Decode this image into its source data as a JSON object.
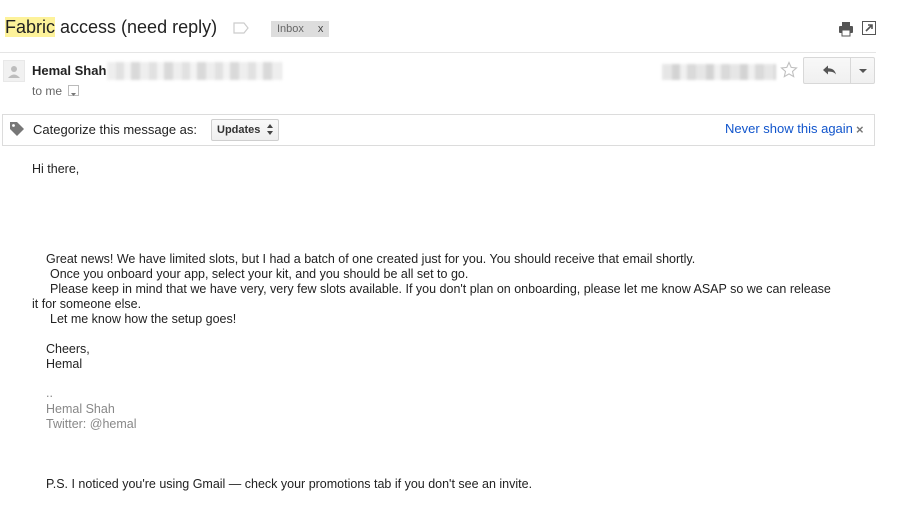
{
  "subject": {
    "highlight": "Fabric",
    "rest": " access (need reply)"
  },
  "inbox_chip": {
    "label": "Inbox",
    "close": "x"
  },
  "sender": {
    "name": "Hemal Shah"
  },
  "recipient": {
    "label": "to me"
  },
  "categorize": {
    "prompt": "Categorize this message as:",
    "selected": "Updates",
    "never_show": "Never show this again",
    "close": "×"
  },
  "body": {
    "greeting": "Hi there,",
    "p1": "Great news! We have limited slots, but I had a batch of one created just for you. You should receive that email shortly.",
    "p2": "Once you onboard your app, select your kit, and you should be all set to go.",
    "p3a": "Please keep in mind that we have very, very few slots available. If you don't plan on onboarding, please let me know ASAP so we can release",
    "p3b": "it for someone else.",
    "p4": "Let me know how the setup goes!",
    "signoff": "Cheers,",
    "signname": "Hemal",
    "dots": "..",
    "sig_name": "Hemal Shah",
    "sig_twitter": "Twitter: @hemal",
    "ps": "P.S. I noticed you're using Gmail — check your promotions tab if you don't see an invite."
  },
  "icons": {
    "label": "label-outline-icon",
    "print": "print-icon",
    "new_window": "new-window-icon",
    "star": "star-outline-icon",
    "reply": "reply-icon",
    "more": "chevron-down-icon",
    "tag": "tag-icon",
    "avatar": "person-icon"
  },
  "colors": {
    "link": "#1155cc",
    "highlight": "#fdf29a",
    "chip_bg": "#dddddd",
    "muted": "#888888"
  }
}
